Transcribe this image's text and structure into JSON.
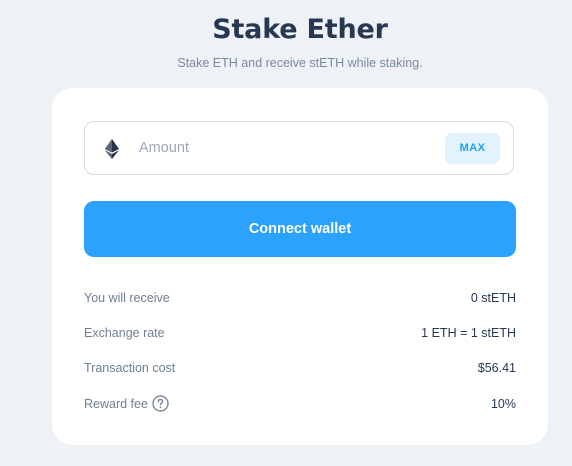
{
  "header": {
    "title": "Stake Ether",
    "subtitle": "Stake ETH and receive stETH while staking."
  },
  "form": {
    "amount_placeholder": "Amount",
    "amount_value": "",
    "token_icon": "ethereum-icon",
    "max_label": "MAX",
    "connect_label": "Connect wallet"
  },
  "details": {
    "rows": [
      {
        "label": "You will receive",
        "value": "0 stETH"
      },
      {
        "label": "Exchange rate",
        "value": "1 ETH = 1 stETH"
      },
      {
        "label": "Transaction cost",
        "value": "$56.41"
      },
      {
        "label": "Reward fee",
        "value": "10%",
        "icon": "help-icon"
      }
    ]
  },
  "colors": {
    "background": "#eef1f5",
    "card": "#ffffff",
    "accent": "#2ca2ff",
    "max_bg": "#e3f3fd",
    "max_text": "#1fa1f2",
    "title_text": "#273852",
    "muted_text": "#6e7f96"
  }
}
